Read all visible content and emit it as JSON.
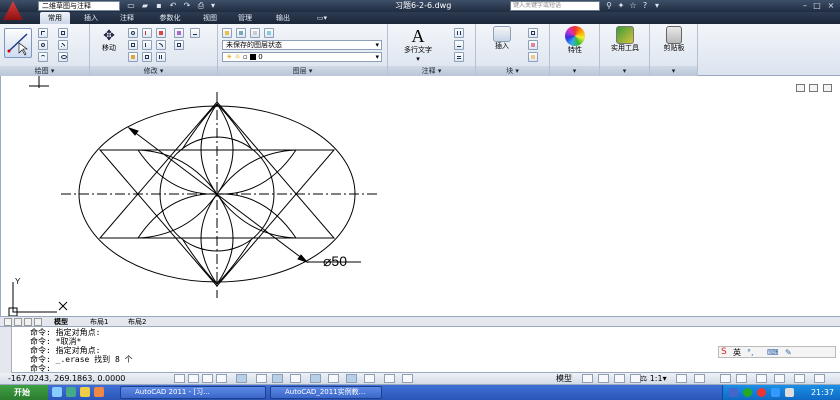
{
  "titlebar": {
    "workspace": "二维草图与注释",
    "document_title": "习题6-2-6.dwg",
    "search_placeholder": "键入关键字或短语"
  },
  "tabs": [
    "常用",
    "插入",
    "注释",
    "参数化",
    "视图",
    "管理",
    "输出"
  ],
  "ribbon": {
    "draw_panel": "绘图",
    "modify_panel": "修改",
    "move_label": "移动",
    "layer_panel": "图层",
    "layer_state": "未保存的图层状态",
    "current_layer": "0",
    "annotation_panel": "注释",
    "multiline_text": "多行文字",
    "block_panel": "块",
    "insert_label": "插入",
    "properties_label": "特性",
    "utilities_label": "实用工具",
    "clipboard_label": "剪贴板"
  },
  "canvas": {
    "dimension_label": "⌀50",
    "ucs_x": "X",
    "ucs_y": "Y"
  },
  "layout_tabs": [
    "模型",
    "布局1",
    "布局2"
  ],
  "command_lines": [
    "命令: 指定对角点:",
    "命令: *取消*",
    "命令: 指定对角点:",
    "命令: _.erase 找到 8 个",
    "命令:"
  ],
  "status": {
    "coordinates": "-167.0243, 269.1863, 0.0000",
    "model_label": "模型",
    "scale": "1:1"
  },
  "taskbar": {
    "start": "开始",
    "task1": "AutoCAD 2011 - [习...",
    "task2": "AutoCAD_2011实例教...",
    "clock": "21:37"
  },
  "ime": {
    "lang": "英"
  }
}
